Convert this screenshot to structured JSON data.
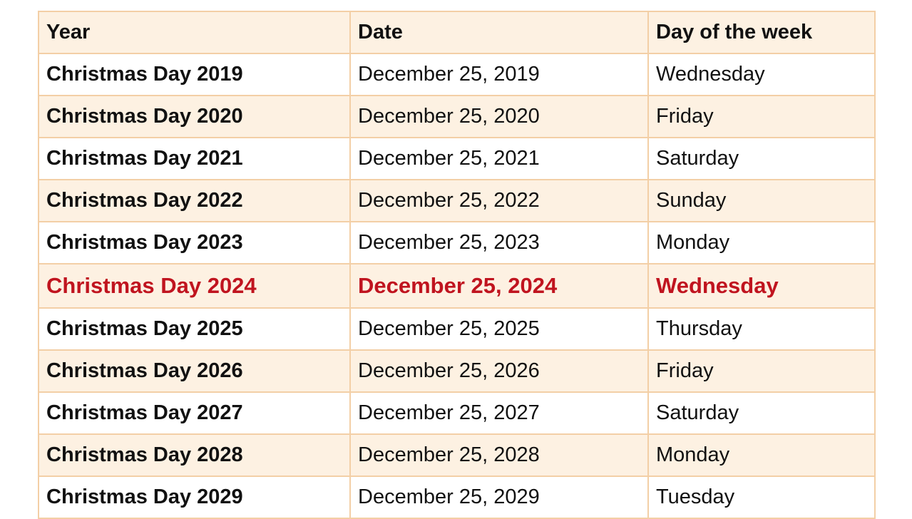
{
  "table": {
    "headers": [
      "Year",
      "Date",
      "Day of the week"
    ],
    "highlight_color": "#c0141f",
    "rows": [
      {
        "year": "Christmas Day 2019",
        "date": "December 25, 2019",
        "day": "Wednesday"
      },
      {
        "year": "Christmas Day 2020",
        "date": "December 25, 2020",
        "day": "Friday"
      },
      {
        "year": "Christmas Day 2021",
        "date": "December 25, 2021",
        "day": "Saturday"
      },
      {
        "year": "Christmas Day 2022",
        "date": "December 25, 2022",
        "day": "Sunday"
      },
      {
        "year": "Christmas Day 2023",
        "date": "December 25, 2023",
        "day": "Monday"
      },
      {
        "year": "Christmas Day 2024",
        "date": "December 25, 2024",
        "day": "Wednesday",
        "highlighted": true
      },
      {
        "year": "Christmas Day 2025",
        "date": "December 25, 2025",
        "day": "Thursday"
      },
      {
        "year": "Christmas Day 2026",
        "date": "December 25, 2026",
        "day": "Friday"
      },
      {
        "year": "Christmas Day 2027",
        "date": "December 25, 2027",
        "day": "Saturday"
      },
      {
        "year": "Christmas Day 2028",
        "date": "December 25, 2028",
        "day": "Monday"
      },
      {
        "year": "Christmas Day 2029",
        "date": "December 25, 2029",
        "day": "Tuesday"
      }
    ]
  }
}
